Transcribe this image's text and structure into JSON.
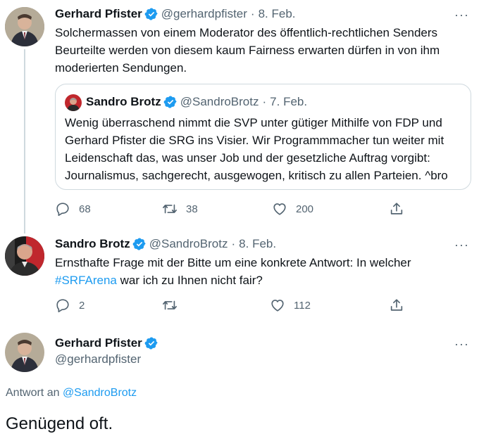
{
  "tweet1": {
    "name": "Gerhard Pfister",
    "handle": "@gerhardpfister",
    "separator": "·",
    "date": "8. Feb.",
    "more": "···",
    "text_lines": [
      "Solchermassen von einem Moderator des öffentlich-rechtlichen Senders",
      "Beurteilte werden von diesem kaum Fairness erwarten dürfen in von ihm",
      "moderierten Sendungen."
    ],
    "quote": {
      "name": "Sandro Brotz",
      "handle": "@SandroBrotz",
      "separator": "·",
      "date": "7. Feb.",
      "text_lines": [
        "Wenig überraschend nimmt die SVP unter gütiger Mithilfe von FDP und",
        "Gerhard Pfister die SRG ins Visier. Wir Programmmacher tun weiter mit",
        "Leidenschaft das, was unser Job und der gesetzliche Auftrag vorgibt:",
        "Journalismus, sachgerecht, ausgewogen, kritisch zu allen Parteien. ^bro"
      ]
    },
    "actions": {
      "replies": "68",
      "retweets": "38",
      "likes": "200"
    }
  },
  "tweet2": {
    "name": "Sandro Brotz",
    "handle": "@SandroBrotz",
    "separator": "·",
    "date": "8. Feb.",
    "more": "···",
    "text_line1": "Ernsthafte Frage mit der Bitte um eine konkrete Antwort: In welcher",
    "hashtag": "#SRFArena",
    "text_line2_rest": " war ich zu Ihnen nicht fair?",
    "actions": {
      "replies": "2",
      "retweets": "",
      "likes": "112"
    }
  },
  "tweet3": {
    "name": "Gerhard Pfister",
    "handle": "@gerhardpfister",
    "more": "···",
    "replying_prefix": "Antwort an ",
    "replying_to": "@SandroBrotz",
    "text": "Genügend oft."
  },
  "icons": {
    "verified": "verified-badge-icon",
    "reply": "reply-icon",
    "retweet": "retweet-icon",
    "like": "heart-icon",
    "share": "share-icon"
  },
  "colors": {
    "accent": "#1d9bf0",
    "secondary_text": "#536471",
    "border": "#cfd9de",
    "text": "#0f1419"
  }
}
